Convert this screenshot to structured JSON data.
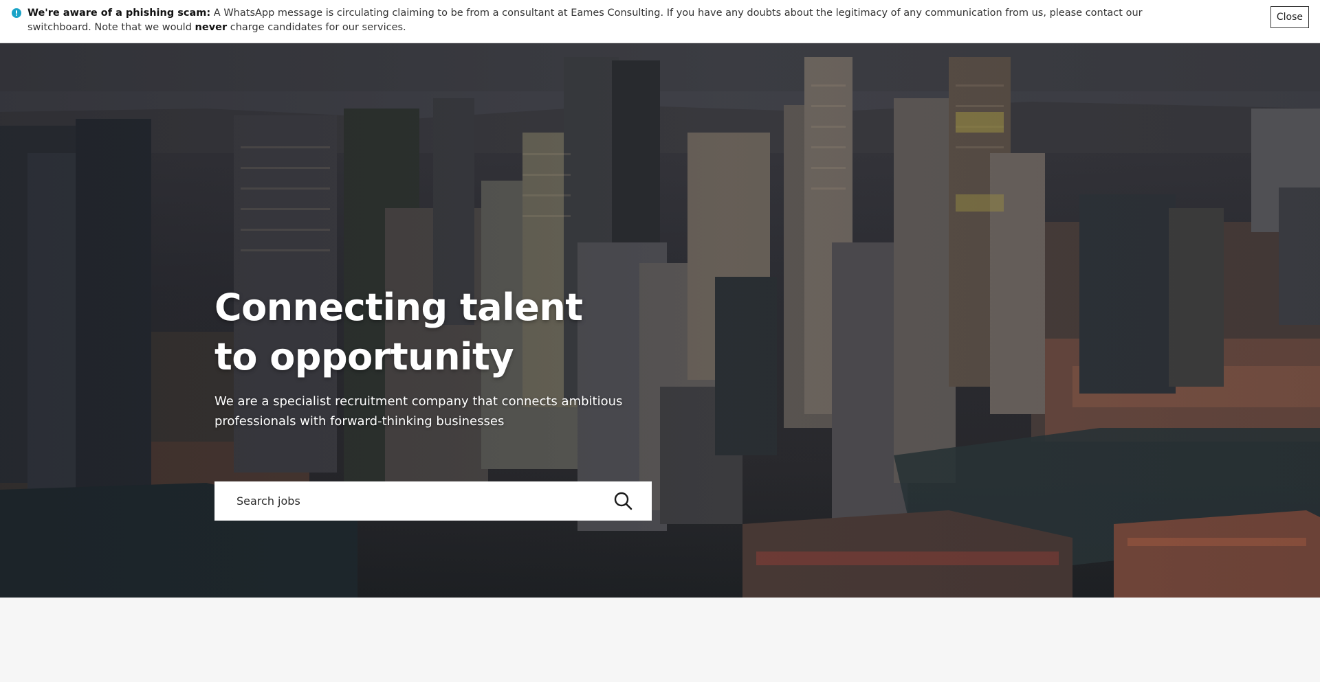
{
  "alert": {
    "lead": "We're aware of a phishing scam:",
    "body_1": " A WhatsApp message is circulating claiming to be from a consultant at Eames Consulting. If you have any doubts about the legitimacy of any communication from us, please contact our switchboard. Note that we would ",
    "emphasis": "never",
    "body_2": " charge candidates for our services.",
    "close_label": "Close",
    "icon": "info-icon",
    "icon_color": "#1aa3c7"
  },
  "hero": {
    "title_line_1": "Connecting talent",
    "title_line_2": "to opportunity",
    "subtitle": "We are a specialist recruitment company that connects ambitious professionals with forward-thinking businesses",
    "search": {
      "placeholder": "Search jobs",
      "value": "",
      "icon": "search-icon"
    }
  },
  "colors": {
    "alert_bg": "#ffffff",
    "hero_text": "#ffffff",
    "search_bg": "#ffffff",
    "page_bg": "#f6f6f6"
  }
}
